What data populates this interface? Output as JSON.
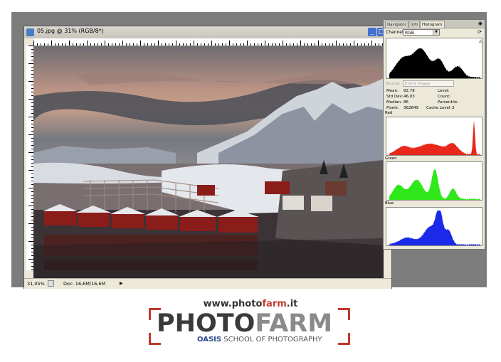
{
  "window": {
    "title": "05.jpg @ 31% (RGB/8*)",
    "minimize": "_",
    "maximize": "□",
    "close": "✕"
  },
  "status": {
    "zoom": "31,05%",
    "doc": "Doc: 16,6M/16,6M",
    "arrow": "▶"
  },
  "palette": {
    "tabs": [
      "Navigator",
      "Info",
      "Histogram"
    ],
    "active_tab": "Histogram",
    "channel_label": "Channel:",
    "channel_value": "RGB",
    "source_label": "Source:",
    "source_value": "Entire Image",
    "stats_left": [
      {
        "label": "Mean:",
        "value": "82,78"
      },
      {
        "label": "Std Dev:",
        "value": "46,03"
      },
      {
        "label": "Median:",
        "value": "86"
      },
      {
        "label": "Pixels:",
        "value": "362849"
      }
    ],
    "stats_right": [
      {
        "label": "Level:",
        "value": ""
      },
      {
        "label": "Count:",
        "value": ""
      },
      {
        "label": "Percentile:",
        "value": ""
      },
      {
        "label": "Cache Level:",
        "value": "3"
      }
    ],
    "channels": [
      {
        "name": "Red",
        "color": "#e8281a"
      },
      {
        "name": "Green",
        "color": "#2ee81a"
      },
      {
        "name": "Blue",
        "color": "#1a2ae8"
      }
    ],
    "composite_color": "#000000"
  },
  "logo": {
    "url_prefix": "www.photo",
    "url_highlight": "farm",
    "url_suffix": ".it",
    "word_dark": "PHOTO",
    "word_light": "FARM",
    "oasis": "OASIS",
    "school": "SCHOOL OF PHOTOGRAPHY",
    "accent": "#c0392b"
  }
}
